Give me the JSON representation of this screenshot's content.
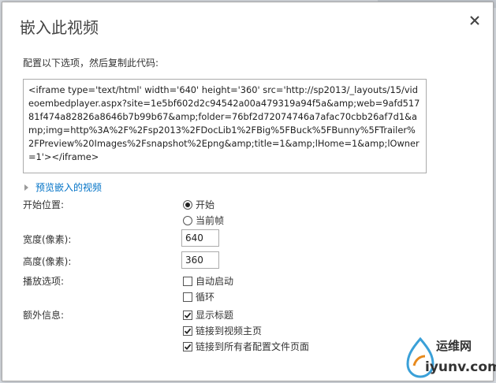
{
  "dialog": {
    "title": "嵌入此视频",
    "prompt": "配置以下选项，然后复制此代码:",
    "embed_code": "<iframe type='text/html' width='640' height='360' src='http://sp2013/_layouts/15/videoembedplayer.aspx?site=1e5bf602d2c94542a00a479319a94f5a&amp;web=9afd51781f474a82826a8646b7b99b67&amp;folder=76bf2d72074746a7afac70cbb26af7d1&amp;img=http%3A%2F%2Fsp2013%2FDocLib1%2FBig%5FBuck%5FBunny%5FTrailer%2FPreview%20Images%2Fsnapshot%2Epng&amp;title=1&amp;lHome=1&amp;lOwner=1'></iframe>",
    "preview_link": "预览嵌入的视频"
  },
  "form": {
    "start_position": {
      "label": "开始位置:",
      "options": [
        {
          "label": "开始",
          "selected": true
        },
        {
          "label": "当前帧",
          "selected": false
        }
      ]
    },
    "width": {
      "label": "宽度(像素):",
      "value": "640"
    },
    "height": {
      "label": "高度(像素):",
      "value": "360"
    },
    "playback": {
      "label": "播放选项:",
      "options": [
        {
          "label": "自动启动",
          "checked": false
        },
        {
          "label": "循环",
          "checked": false
        }
      ]
    },
    "extra": {
      "label": "额外信息:",
      "options": [
        {
          "label": "显示标题",
          "checked": true
        },
        {
          "label": "链接到视频主页",
          "checked": true
        },
        {
          "label": "链接到所有者配置文件页面",
          "checked": true
        }
      ]
    }
  },
  "watermark": {
    "name": "运维网",
    "domain": "iyunv.com"
  },
  "icons": [
    "close-icon",
    "expand-triangle-icon",
    "radio-selected-icon",
    "radio-unselected-icon",
    "checkbox-checked-icon",
    "checkbox-unchecked-icon"
  ],
  "colors": {
    "link": "#0072c6",
    "border": "#ababab",
    "text": "#333333"
  }
}
